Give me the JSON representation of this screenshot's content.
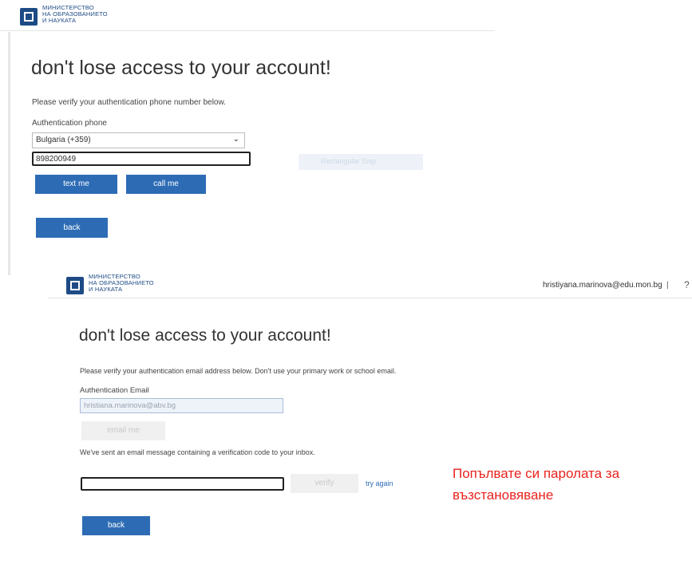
{
  "top": {
    "logo_text": [
      "МИНИСТЕРСТВО",
      "НА ОБРАЗОВАНИЕТО",
      "И НАУКАТА"
    ],
    "title": "don't lose access to your account!",
    "instruction": "Please verify your authentication phone number below.",
    "phone_label": "Authentication phone",
    "country_value": "Bulgaria (+359)",
    "phone_value": "898200949",
    "text_me": "text me",
    "call_me": "call me",
    "ghost_label": "Rectangular Snip",
    "back": "back"
  },
  "bottom": {
    "logo_text": [
      "МИНИСТЕРСТВО",
      "НА ОБРАЗОВАНИЕТО",
      "И НАУКАТА"
    ],
    "user_email": "hristiyana.marinova@edu.mon.bg",
    "separator": "|",
    "help": "?",
    "title": "don't lose access to your account!",
    "instruction": "Please verify your authentication email address below. Don't use your primary work or school email.",
    "email_label": "Authentication Email",
    "email_value": "hristiana.marinova@abv.bg",
    "email_me": "email me",
    "sent_message": "We've sent an email message containing a verification code to your inbox.",
    "code_value": "",
    "verify": "verify",
    "try_again": "try again",
    "back": "back"
  },
  "annotation": {
    "line1": "Попълвате си паролата за",
    "line2": "възстановяване"
  },
  "colors": {
    "primary": "#2d6cb5",
    "annotation": "#e8231e"
  },
  "icons": {
    "logo": "ministry-logo-icon",
    "dropdown": "chevron-down-icon"
  }
}
